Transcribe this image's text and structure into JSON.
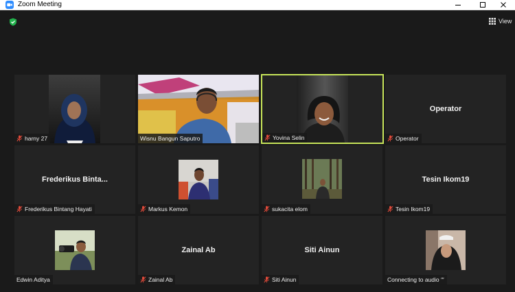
{
  "window": {
    "title": "Zoom Meeting"
  },
  "colors": {
    "accent_active": "#c8e65a",
    "mic_muted": "#e04a3a",
    "shield": "#22b24c",
    "app_icon": "#2d8cff"
  },
  "toolbar": {
    "view_label": "View"
  },
  "participants": [
    {
      "name": "harny 27",
      "big_name": "",
      "muted": true,
      "video": true
    },
    {
      "name": "Wisnu  Bangun Saputro",
      "big_name": "",
      "muted": false,
      "video": true
    },
    {
      "name": "Yovina Selin",
      "big_name": "",
      "muted": true,
      "video": true,
      "active_speaker": true
    },
    {
      "name": "Operator",
      "big_name": "Operator",
      "muted": true,
      "video": false
    },
    {
      "name": "Frederikus Bintang Hayati",
      "big_name": "Frederikus  Binta...",
      "muted": true,
      "video": false
    },
    {
      "name": "Markus Kemon",
      "big_name": "",
      "muted": true,
      "video": true
    },
    {
      "name": "sukacita elom",
      "big_name": "",
      "muted": true,
      "video": true
    },
    {
      "name": "Tesin Ikom19",
      "big_name": "Tesin Ikom19",
      "muted": true,
      "video": false
    },
    {
      "name": "Edwin Aditya",
      "big_name": "",
      "muted": false,
      "video": true
    },
    {
      "name": "Zainal Ab",
      "big_name": "Zainal Ab",
      "muted": true,
      "video": false
    },
    {
      "name": "Siti Ainun",
      "big_name": "Siti Ainun",
      "muted": true,
      "video": false
    },
    {
      "name": "Connecting to audio ′′′",
      "big_name": "",
      "muted": false,
      "video": true
    }
  ]
}
